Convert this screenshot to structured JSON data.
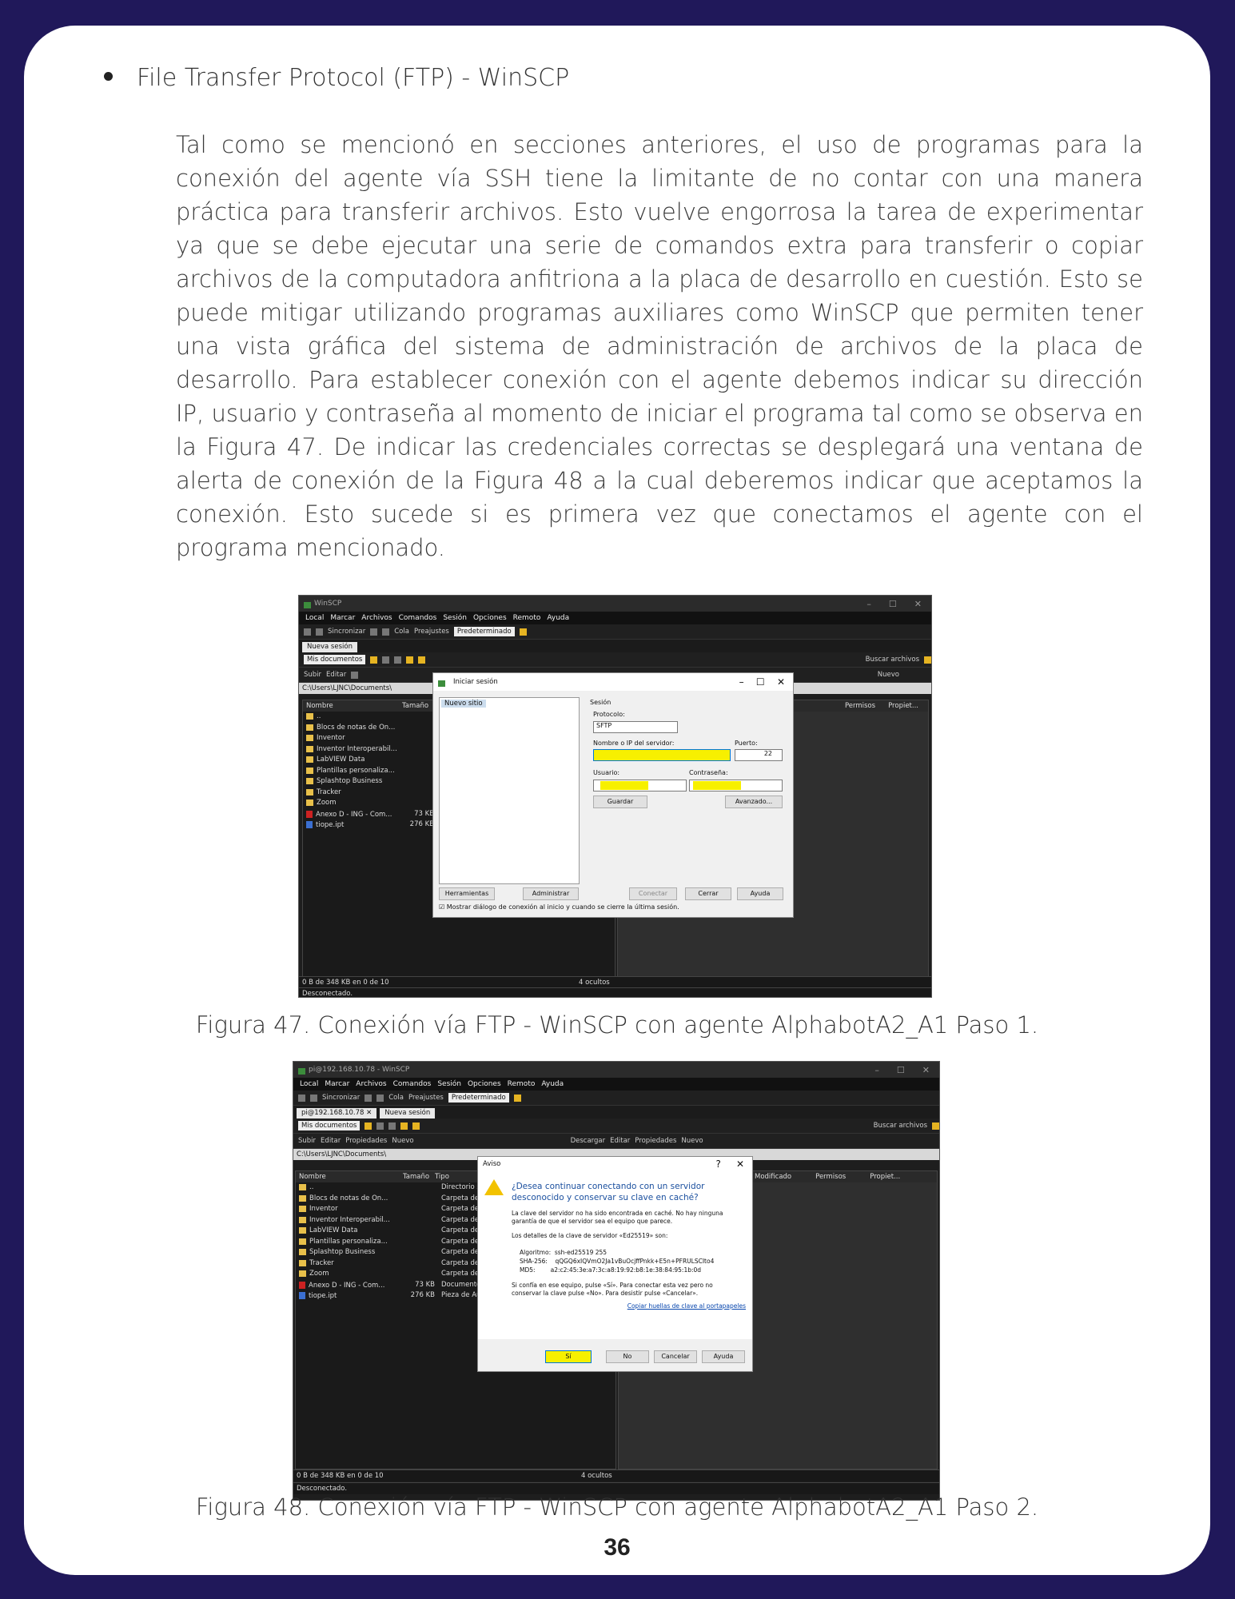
{
  "bullet": "File Transfer Protocol (FTP) - WinSCP",
  "paragraph": "Tal como se mencionó en secciones anteriores, el uso de programas para la conexión del agente vía SSH tiene la limitante de no contar con una manera práctica para transferir archivos. Esto vuelve engorrosa la tarea de experimentar ya que se debe ejecutar una serie de comandos extra para transferir o copiar archivos de la computadora anfitriona a la placa de desarrollo en cuestión. Esto se puede mitigar utilizando programas auxiliares como WinSCP que permiten tener una vista gráfica del sistema de administración de archivos de la placa de desarrollo. Para establecer conexión con el agente debemos indicar su dirección IP, usuario y contraseña al momento de iniciar el programa tal como se observa en la Figura 47. De indicar las credenciales correctas se desplegará una ventana de alerta de conexión de la Figura 48 a la cual deberemos indicar que aceptamos la conexión. Esto sucede si es primera vez que conectamos el agente con el programa mencionado.",
  "figure47": {
    "caption": "Figura 47. Conexión vía FTP - WinSCP con agente AlphabotA2_A1 Paso 1.",
    "window_title": "WinSCP",
    "menu": [
      "Local",
      "Marcar",
      "Archivos",
      "Comandos",
      "Sesión",
      "Opciones",
      "Remoto",
      "Ayuda"
    ],
    "toolbar_sync": "Sincronizar",
    "toolbar_queue": "Cola",
    "toolbar_presets": "Preajustes",
    "toolbar_preset_value": "Predeterminado",
    "tab": "Nueva sesión",
    "local_dir": "Mis documentos",
    "find_files": "Buscar archivos",
    "upload": "Subir",
    "edit": "Editar",
    "new": "Nuevo",
    "path": "C:\\Users\\LJNC\\Documents\\",
    "col_name": "Nombre",
    "col_size": "Tamaño",
    "col_perms": "Permisos",
    "col_owner": "Propiet...",
    "files": [
      {
        "name": "..",
        "size": "",
        "kind": "up"
      },
      {
        "name": "Blocs de notas de On...",
        "size": "",
        "kind": "folder"
      },
      {
        "name": "Inventor",
        "size": "",
        "kind": "folder"
      },
      {
        "name": "Inventor Interoperabil...",
        "size": "",
        "kind": "folder"
      },
      {
        "name": "LabVIEW Data",
        "size": "",
        "kind": "folder"
      },
      {
        "name": "Plantillas personaliza...",
        "size": "",
        "kind": "folder"
      },
      {
        "name": "Splashtop Business",
        "size": "",
        "kind": "folder"
      },
      {
        "name": "Tracker",
        "size": "",
        "kind": "folder"
      },
      {
        "name": "Zoom",
        "size": "",
        "kind": "folder"
      },
      {
        "name": "Anexo D - ING - Com...",
        "size": "73 KB",
        "kind": "pdf"
      },
      {
        "name": "tiope.ipt",
        "size": "276 KB",
        "kind": "ipt"
      }
    ],
    "status_left": "0 B de 348 KB en 0 de 10",
    "status_right": "4 ocultos",
    "status_conn": "Desconectado.",
    "dialog": {
      "title": "Iniciar sesión",
      "site": "Nuevo sitio",
      "session": "Sesión",
      "protocol_label": "Protocolo:",
      "protocol_value": "SFTP",
      "host_label": "Nombre o IP del servidor:",
      "port_label": "Puerto:",
      "port_value": "22",
      "user_label": "Usuario:",
      "pass_label": "Contraseña:",
      "save": "Guardar",
      "advanced": "Avanzado...",
      "tools": "Herramientas",
      "manage": "Administrar",
      "connect": "Conectar",
      "close": "Cerrar",
      "help": "Ayuda",
      "checkbox": "Mostrar diálogo de conexión al inicio y cuando se cierre la última sesión."
    }
  },
  "figure48": {
    "caption": "Figura 48. Conexión vía FTP - WinSCP con agente AlphabotA2_A1 Paso 2.",
    "window_title": "pi@192.168.10.78 - WinSCP",
    "tab1": "pi@192.168.10.78",
    "tab2": "Nueva sesión",
    "col_type": "Tipo",
    "col_modified": "Modificado",
    "properties": "Propiedades",
    "download": "Descargar",
    "types": [
      "Directorio supe",
      "Carpeta de arc",
      "Carpeta de arc",
      "Carpeta de arc",
      "Carpeta de arc",
      "Carpeta de arc",
      "Carpeta de arc",
      "Carpeta de arc",
      "Carpeta de arc",
      "Documento Ac",
      "Pieza de Autod"
    ],
    "dialog": {
      "title": "Aviso",
      "question": "¿Desea continuar conectando con un servidor desconocido y conservar su clave en caché?",
      "p1": "La clave del servidor no ha sido encontrada en caché. No hay ninguna garantía de que el servidor sea el equipo que parece.",
      "p2": "Los detalles de la clave de servidor «Ed25519» son:",
      "algo": "Algoritmo:  ssh-ed25519 255",
      "sha": "SHA-256:    qQGQ6xIQVmO2Ja1vBuOcjffPnkk+E5n+PFRULSCIto4",
      "md5": "MD5:        a2:c2:45:3e:a7:3c:a8:19:92:b8:1e:38:84:95:1b:0d",
      "p3": "Si confía en ese equipo, pulse «Sí». Para conectar esta vez pero no conservar la clave pulse «No». Para desistir pulse «Cancelar».",
      "link": "Copiar huellas de clave al portapapeles",
      "yes": "Sí",
      "no": "No",
      "cancel": "Cancelar",
      "help": "Ayuda"
    }
  },
  "page_number": "36"
}
